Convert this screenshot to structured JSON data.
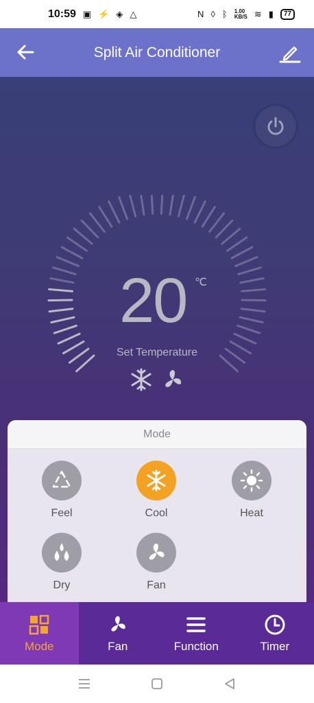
{
  "status_bar": {
    "time": "10:59",
    "speed_value": "1.00",
    "speed_unit": "KB/S",
    "battery": "77"
  },
  "header": {
    "title": "Split Air Conditioner",
    "back_icon": "arrow-left-icon",
    "edit_icon": "pencil-icon"
  },
  "thermostat": {
    "temperature": "20",
    "unit": "℃",
    "label": "Set Temperature",
    "mode_indicator_icon": "snowflake-icon",
    "fan_indicator_icon": "fan-icon"
  },
  "mode_panel": {
    "title": "Mode",
    "items": [
      {
        "label": "Feel",
        "icon": "recycle-icon",
        "active": false
      },
      {
        "label": "Cool",
        "icon": "snowflake-icon",
        "active": true
      },
      {
        "label": "Heat",
        "icon": "sun-icon",
        "active": false
      },
      {
        "label": "Dry",
        "icon": "droplets-icon",
        "active": false
      },
      {
        "label": "Fan",
        "icon": "fan-icon",
        "active": false
      }
    ]
  },
  "bottom_nav": {
    "tabs": [
      {
        "label": "Mode",
        "icon": "grid-icon",
        "active": true
      },
      {
        "label": "Fan",
        "icon": "fan-icon",
        "active": false
      },
      {
        "label": "Function",
        "icon": "menu-icon",
        "active": false
      },
      {
        "label": "Timer",
        "icon": "clock-icon",
        "active": false
      }
    ]
  },
  "colors": {
    "header_bg": "#6c72c9",
    "accent": "#f3a223",
    "nav_bg": "#5a2a96",
    "nav_active_bg": "#7f39b5"
  }
}
